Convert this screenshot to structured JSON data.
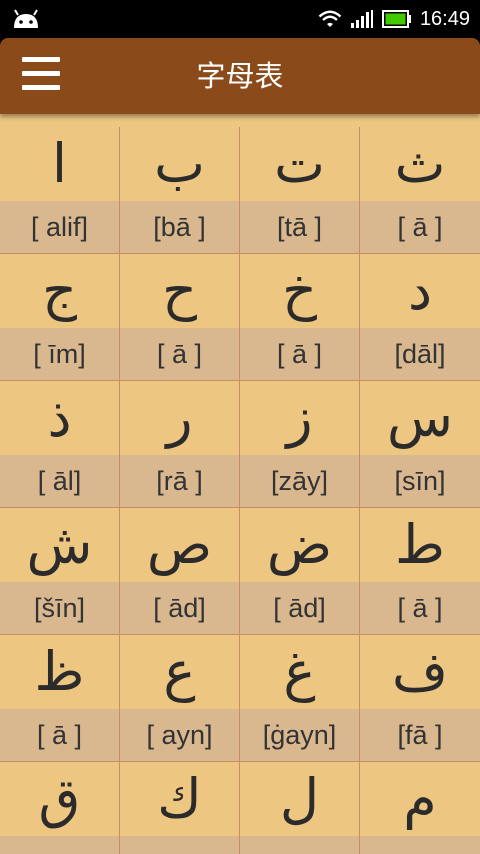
{
  "status": {
    "time": "16:49"
  },
  "appbar": {
    "title": "字母表"
  },
  "letters": [
    [
      {
        "ar": "ا",
        "name": "[ alif]"
      },
      {
        "ar": "ب",
        "name": "[bā ]"
      },
      {
        "ar": "ت",
        "name": "[tā ]"
      },
      {
        "ar": "ث",
        "name": "[ ā ]"
      }
    ],
    [
      {
        "ar": "ج",
        "name": "[ īm]"
      },
      {
        "ar": "ح",
        "name": "[ ā ]"
      },
      {
        "ar": "خ",
        "name": "[ ā ]"
      },
      {
        "ar": "د",
        "name": "[dāl]"
      }
    ],
    [
      {
        "ar": "ذ",
        "name": "[ āl]"
      },
      {
        "ar": "ر",
        "name": "[rā ]"
      },
      {
        "ar": "ز",
        "name": "[zāy]"
      },
      {
        "ar": "س",
        "name": "[sīn]"
      }
    ],
    [
      {
        "ar": "ش",
        "name": "[šīn]"
      },
      {
        "ar": "ص",
        "name": "[ ād]"
      },
      {
        "ar": "ض",
        "name": "[ ād]"
      },
      {
        "ar": "ط",
        "name": "[ ā ]"
      }
    ],
    [
      {
        "ar": "ظ",
        "name": "[ ā ]"
      },
      {
        "ar": "ع",
        "name": "[ ayn]"
      },
      {
        "ar": "غ",
        "name": "[ġayn]"
      },
      {
        "ar": "ف",
        "name": "[fā ]"
      }
    ],
    [
      {
        "ar": "ق",
        "name": ""
      },
      {
        "ar": "ك",
        "name": ""
      },
      {
        "ar": "ل",
        "name": ""
      },
      {
        "ar": "م",
        "name": ""
      }
    ]
  ],
  "colors": {
    "appbar": "#8a4a19",
    "letter_bg": "#edc682",
    "name_bg": "#d9b890",
    "battery": "#43c900"
  }
}
